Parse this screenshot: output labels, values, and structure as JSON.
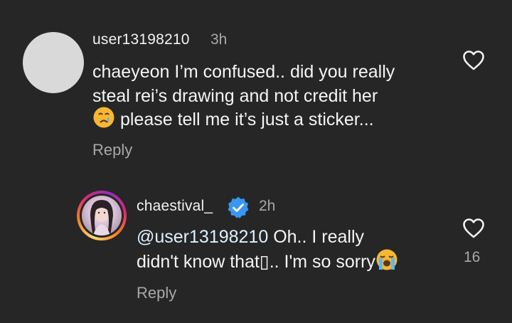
{
  "comment": {
    "username": "user13198210",
    "time": "3h",
    "lines": [
      "chaeyeon I’m confused.. did you really",
      "steal rei’s drawing and not credit her",
      "please tell me it’s just a sticker..."
    ],
    "emoji": "crying-face-emoji",
    "reply_label": "Reply",
    "like_icon": "heart-outline-icon"
  },
  "reply": {
    "username": "chaestival_",
    "verified_icon": "verified-badge-icon",
    "time": "2h",
    "mention": "@user13198210",
    "line1_rest": " Oh.. I really",
    "line2": "didn't know that▯.. I'm so sorry",
    "emoji": "loudly-crying-face-emoji",
    "reply_label": "Reply",
    "like_count": "16",
    "like_icon": "heart-outline-icon"
  },
  "colors": {
    "background": "#262626",
    "text": "#f5f5f5",
    "secondary": "#a8a8a8",
    "mention": "#e0f1ff",
    "verified": "#3897f0"
  }
}
